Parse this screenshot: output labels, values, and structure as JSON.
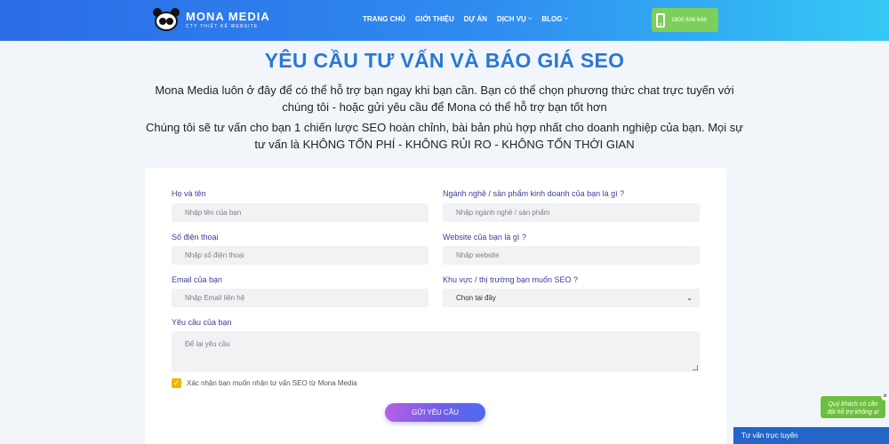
{
  "header": {
    "logo_title": "MONA MEDIA",
    "logo_subtitle": "CTY THIẾT KẾ WEBSITE",
    "nav": [
      {
        "label": "TRANG CHỦ",
        "has_caret": false
      },
      {
        "label": "GIỚI THIỆU",
        "has_caret": false
      },
      {
        "label": "DỰ ÁN",
        "has_caret": false
      },
      {
        "label": "DỊCH VỤ",
        "has_caret": true
      },
      {
        "label": "BLOG",
        "has_caret": true
      }
    ],
    "hotline": "1900 636 648"
  },
  "page": {
    "title": "YÊU CẦU TƯ VẤN VÀ BÁO GIÁ SEO",
    "intro_1": "Mona Media luôn ở đây để có thể hỗ trợ bạn ngay khi bạn cần. Bạn có thể chọn phương thức chat trực tuyến với chúng tôi - hoặc gửi yêu cầu để Mona có thể hỗ trợ bạn tốt hơn",
    "intro_2": "Chúng tôi sẽ tư vấn cho bạn 1 chiến lược SEO hoàn chỉnh, bài bản phù hợp nhất cho doanh nghiệp của bạn. Mọi sự tư vấn là KHÔNG TỐN PHÍ - KHÔNG RỦI RO - KHÔNG TỐN THỜI GIAN"
  },
  "form": {
    "name_label": "Họ và tên",
    "name_placeholder": "Nhập tên của bạn",
    "industry_label": "Ngành nghề / sản phẩm kinh doanh của bạn là gì ?",
    "industry_placeholder": "Nhập ngành nghề / sản phẩm",
    "phone_label": "Số điện thoại",
    "phone_placeholder": "Nhập số điện thoại",
    "website_label": "Website của bạn là gì ?",
    "website_placeholder": "Nhập website",
    "email_label": "Email của bạn",
    "email_placeholder": "Nhập Email liên hệ",
    "region_label": "Khu vực / thị trường bạn muốn SEO ?",
    "region_value": "Chọn tại đây",
    "request_label": "Yêu cầu của bạn",
    "request_placeholder": "Để lại yêu cầu",
    "consent_label": "Xác nhận bạn muốn nhận tư vấn SEO từ Mona Media",
    "consent_checked": true,
    "submit_label": "GỬI YÊU CẦU"
  },
  "chat": {
    "bubble_text": "Quý khách có cần đội hỗ trợ không ạ!",
    "bar_label": "Tư vấn trực tuyến"
  }
}
